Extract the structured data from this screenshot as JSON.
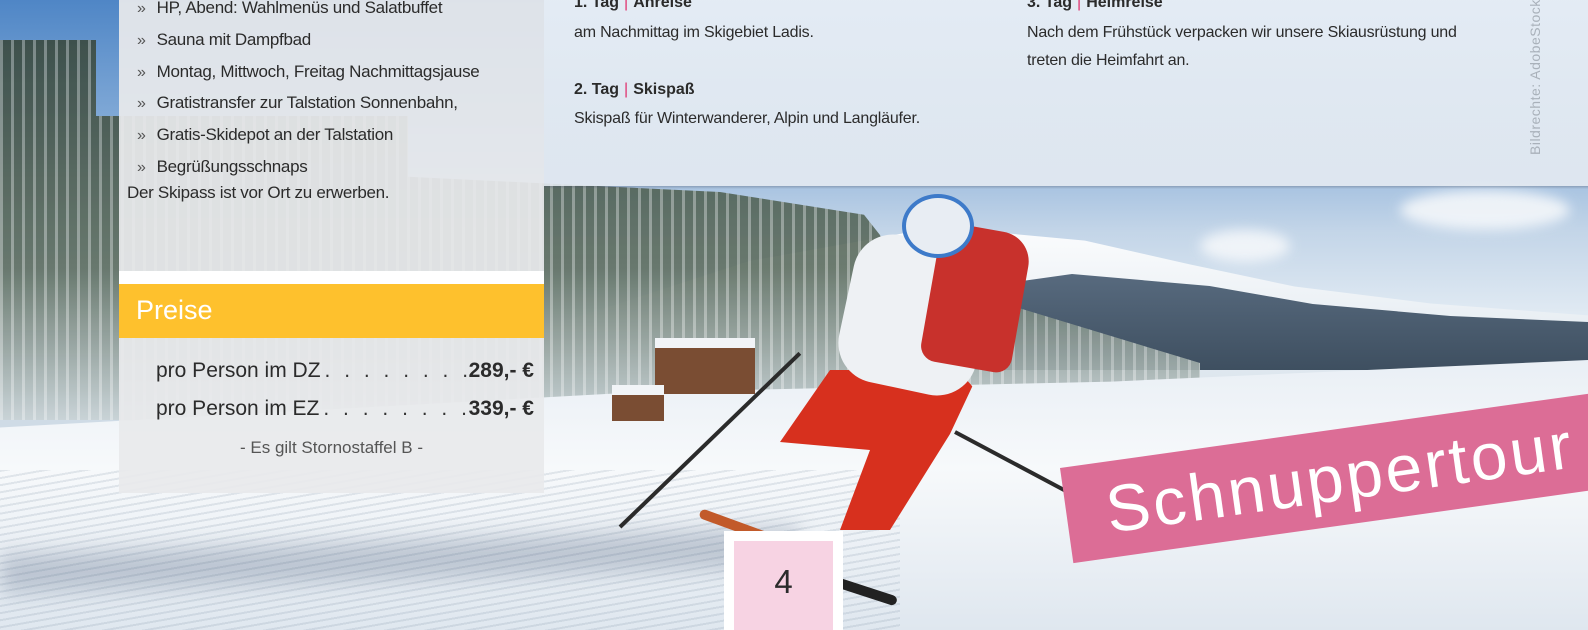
{
  "features": [
    "HP, Abend: Wahlmenüs und Salatbuffet",
    "Sauna mit Dampfbad",
    "Montag, Mittwoch, Freitag Nachmittagsjause",
    "Gratistransfer zur Talstation Sonnenbahn,",
    "Gratis-Skidepot an der Talstation",
    "Begrüßungsschnaps"
  ],
  "feature_marker": "»",
  "skipass_note": "Der Skipass ist vor Ort zu erwerben.",
  "prices": {
    "title": "Preise",
    "rows": [
      {
        "label": "pro Person im DZ",
        "dots": ". . . . . . . . .",
        "amount": "289,- €"
      },
      {
        "label": "pro Person im EZ",
        "dots": ". . . . . . . . . .",
        "amount": "339,- €"
      }
    ],
    "storno": "- Es gilt Stornostaffel B -"
  },
  "itinerary": {
    "separator": "|",
    "days": [
      {
        "num": "1. Tag",
        "name": "Anreise",
        "text": "am Nachmittag im Skigebiet Ladis."
      },
      {
        "num": "2. Tag",
        "name": "Skispaß",
        "text": "Skispaß für Winterwanderer, Alpin und Langläufer."
      },
      {
        "num": "3. Tag",
        "name": "Heimreise",
        "text": "Nach dem Frühstück verpacken wir unsere Skiausrüstung und treten die Heimfahrt an."
      }
    ]
  },
  "credit": "Bildrechte: AdobeStock",
  "page_number": "4",
  "banner": "Schnuppertour",
  "colors": {
    "accent_yellow": "#fec12d",
    "accent_pink": "#dc6d96",
    "separator_pink": "#e0326f",
    "page_box_pink": "#f7d3e3"
  }
}
